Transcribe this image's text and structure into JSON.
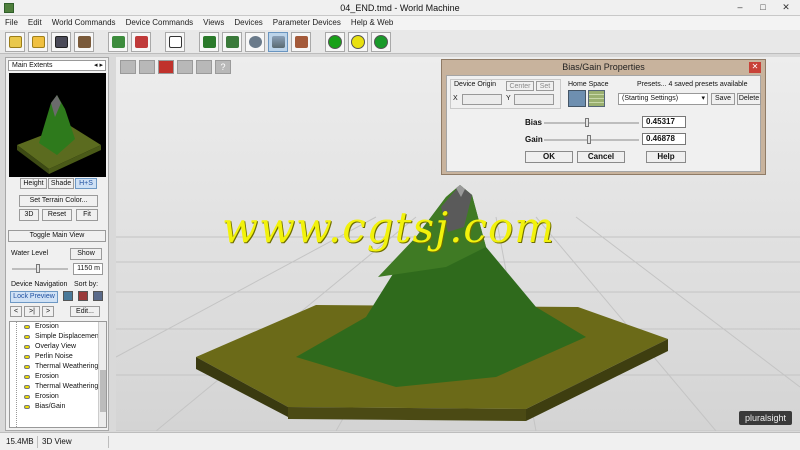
{
  "window": {
    "title": "04_END.tmd - World Machine"
  },
  "menu": [
    "File",
    "Edit",
    "World Commands",
    "Device Commands",
    "Views",
    "Devices",
    "Parameter Devices",
    "Help & Web"
  ],
  "toolbar": {
    "buttons": [
      "new-file-icon",
      "open-folder-icon",
      "save-icon",
      "settings-wrench-icon",
      "layout-view-icon",
      "device-icon",
      "dice-icon",
      "extents-icon",
      "water-icon",
      "sphere-icon",
      "terrain-3d-icon",
      "texture-icon"
    ],
    "circles": [
      {
        "name": "build-green-icon",
        "color": "#18a018"
      },
      {
        "name": "build-yellow-icon",
        "color": "#e8e010"
      },
      {
        "name": "build-target-icon",
        "color": "#1a9a2a"
      }
    ]
  },
  "left_panel": {
    "extents_label": "Main Extents",
    "view_buttons": [
      "Height",
      "Shade",
      "H+S"
    ],
    "set_color": "Set Terrain Color...",
    "buttons_row": [
      "3D",
      "Reset",
      "Fit"
    ],
    "toggle_main_view": "Toggle Main View",
    "water_level_label": "Water Level",
    "water_show": "Show",
    "water_value": "1150 m",
    "device_nav_label": "Device Navigation",
    "sort_by_label": "Sort by:",
    "lock_preview": "Lock Preview",
    "nav_buttons": [
      "<",
      ">|",
      ">"
    ],
    "edit_button": "Edit...",
    "devices": [
      "Erosion",
      "Simple Displacemen",
      "Overlay View",
      "Perlin Noise",
      "Thermal Weathering",
      "Erosion",
      "Thermal Weathering",
      "Erosion",
      "Bias/Gain"
    ]
  },
  "dialog": {
    "title": "Bias/Gain Properties",
    "device_origin_label": "Device Origin",
    "center_button": "Center",
    "set_button": "Set",
    "x_label": "X",
    "y_label": "Y",
    "home_space_label": "Home Space",
    "presets_label": "Presets... 4 saved presets available",
    "preset_selected": "(Starting Settings)",
    "save_button": "Save",
    "delete_button": "Delete",
    "bias_label": "Bias",
    "bias_value": "0.45317",
    "bias_fraction": 0.45317,
    "gain_label": "Gain",
    "gain_value": "0.46878",
    "gain_fraction": 0.46878,
    "ok_button": "OK",
    "cancel_button": "Cancel",
    "help_button": "Help"
  },
  "viewport": {
    "tools": [
      "grid-icon",
      "layers-icon",
      "render-icon",
      "camera-icon",
      "light-icon",
      "help-icon"
    ],
    "help_glyph": "?",
    "watermark": "www.cgtsj.com",
    "brand": "pluralsight"
  },
  "status": {
    "memory": "15.4MB",
    "view": "3D View"
  },
  "colors": {
    "dialog_frame": "#c8b39d",
    "selected_button": "#cfe1f5",
    "watermark": "#f2f20c"
  }
}
